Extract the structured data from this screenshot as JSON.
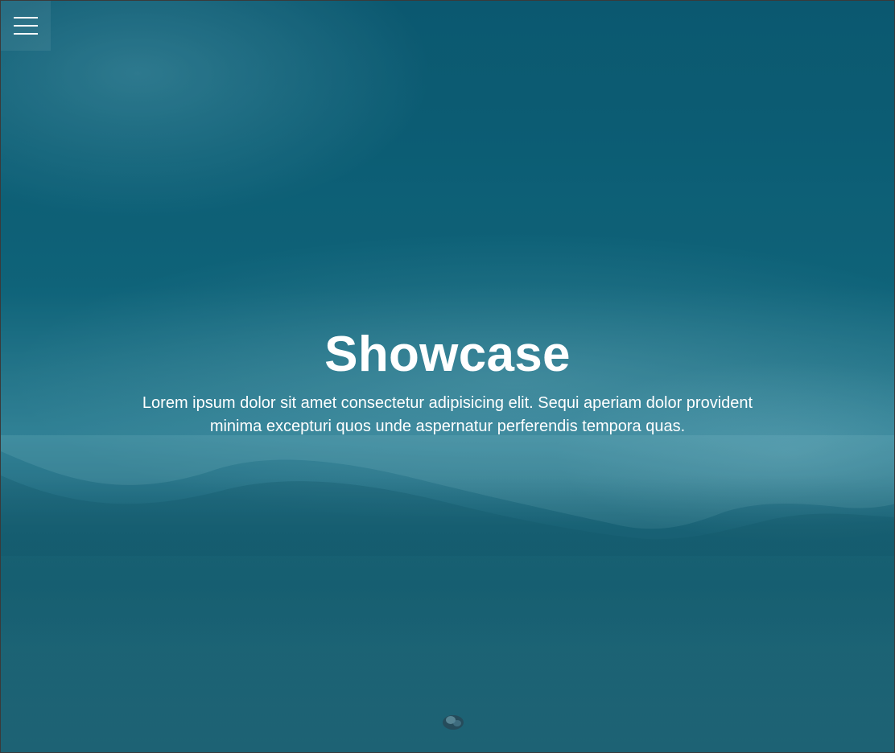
{
  "showcase": {
    "title": "Showcase",
    "text": "Lorem ipsum dolor sit amet consectetur adipisicing elit. Sequi aperiam dolor provident minima excepturi quos unde aspernatur perferendis tempora quas."
  },
  "icons": {
    "menu": "hamburger-menu-icon"
  },
  "colors": {
    "background": "#0f5d72",
    "text": "#ffffff"
  }
}
